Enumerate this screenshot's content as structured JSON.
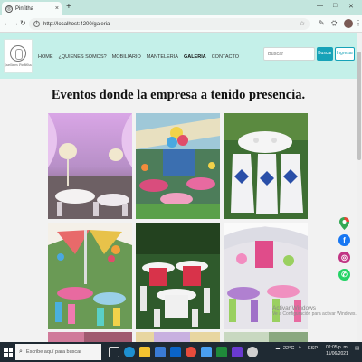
{
  "browser": {
    "tab_title": "Pinfitha",
    "tab_close": "×",
    "new_tab": "+",
    "url": "http://localhost:4200/galeria",
    "min": "—",
    "max": "□",
    "close": "✕",
    "ext1": "✎",
    "ext2": "⛭",
    "menu": "⋮"
  },
  "nav": {
    "logo_text": "Jardines Pinfitha",
    "items": [
      "HOME",
      "¿QUIENES SOMOS?",
      "MOBILIARIO",
      "MANTELERIA",
      "GALERIA",
      "CONTACTO"
    ],
    "active_index": 4,
    "search_placeholder": "Buscar",
    "buscar_label": "Buscar",
    "ingresar_label": "Ingresar"
  },
  "main": {
    "heading": "Eventos donde la empresa a tenido presencia."
  },
  "watermark": {
    "line1": "Activar Windows",
    "line2": "Ve a Configuración para activar Windows."
  },
  "social": [
    {
      "name": "maps",
      "color": "#e8453c"
    },
    {
      "name": "facebook",
      "color": "#1877f2",
      "glyph": "f"
    },
    {
      "name": "instagram",
      "color": "#c13584",
      "glyph": "◎"
    },
    {
      "name": "whatsapp",
      "color": "#25d366",
      "glyph": "✆"
    }
  ],
  "taskbar": {
    "search_text": "Escribe aquí para buscar",
    "temp": "22°C",
    "lang": "ESP",
    "time": "02:05 p. m.",
    "date": "11/06/2021"
  },
  "colors": {
    "header_bg": "#c4f0e9",
    "accent": "#17a2b8",
    "taskbar": "#1f2a33"
  }
}
